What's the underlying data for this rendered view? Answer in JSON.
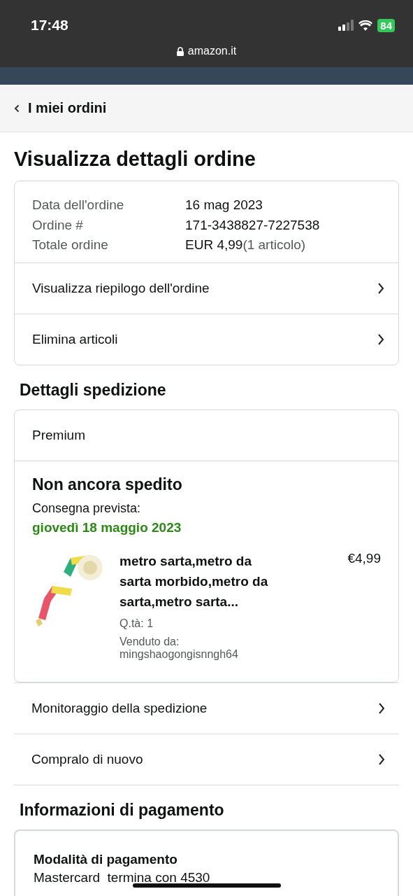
{
  "status_bar": {
    "time": "17:48",
    "battery": "84"
  },
  "browser": {
    "address": "amazon.it"
  },
  "breadcrumb": {
    "label": "I miei ordini"
  },
  "page_title": "Visualizza dettagli ordine",
  "order_info": {
    "rows": [
      {
        "label": "Data dell'ordine",
        "value": "16 mag 2023"
      },
      {
        "label": "Ordine #",
        "value": "171-3438827-7227538"
      },
      {
        "label": "Totale ordine",
        "value": "EUR 4,99",
        "note": "(1 articolo)"
      }
    ],
    "links": [
      "Visualizza riepilogo dell'ordine",
      "Elimina articoli"
    ]
  },
  "shipping": {
    "heading": "Dettagli spedizione",
    "service": "Premium",
    "status": "Non ancora spedito",
    "delivery_label": "Consegna prevista:",
    "delivery_date": "giovedì 18 maggio 2023",
    "item": {
      "kind": "picture",
      "title": "metro sarta,metro da sarta morbido,metro da sarta,metro sarta...",
      "price": "€4,99",
      "quantity": "Q.tà: 1",
      "seller": "Venduto da: mingshaogongisnngh64"
    },
    "links": [
      "Monitoraggio della spedizione",
      "Compralo di nuovo"
    ]
  },
  "payment": {
    "heading": "Informazioni di pagamento",
    "method_label": "Modalità di pagamento",
    "method_value": "Mastercard  termina con 4530"
  }
}
